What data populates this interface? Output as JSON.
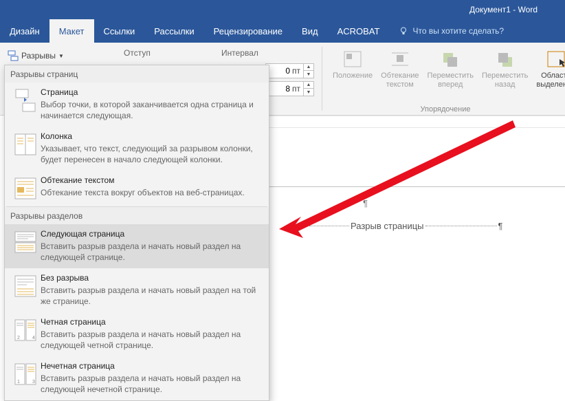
{
  "title": "Документ1 - Word",
  "tabs": [
    "Дизайн",
    "Макет",
    "Ссылки",
    "Рассылки",
    "Рецензирование",
    "Вид",
    "ACROBAT"
  ],
  "active_tab": 1,
  "tell_me": "Что вы хотите сделать?",
  "breaks_button": "Разрывы",
  "indent_label": "Отступ",
  "interval_label": "Интервал",
  "interval_before": "0",
  "interval_after": "8",
  "interval_unit": "пт",
  "arrange": {
    "position": "Положение",
    "wrap": "Обтекание текстом",
    "forward": "Переместить вперед",
    "backward": "Переместить назад",
    "selection": "Область выделения",
    "group_label": "Упорядочение"
  },
  "menu": {
    "sect1": "Разрывы страниц",
    "sect2": "Разрывы разделов",
    "items": [
      {
        "title": "Страница",
        "desc": "Выбор точки, в которой заканчивается одна страница и начинается следующая."
      },
      {
        "title": "Колонка",
        "desc": "Указывает, что текст, следующий за разрывом колонки, будет перенесен в начало следующей колонки."
      },
      {
        "title": "Обтекание текстом",
        "desc": "Обтекание текста вокруг объектов на веб-страницах."
      },
      {
        "title": "Следующая страница",
        "desc": "Вставить разрыв раздела и начать новый раздел на следующей странице."
      },
      {
        "title": "Без разрыва",
        "desc": "Вставить разрыв раздела и начать новый раздел на той же странице."
      },
      {
        "title": "Четная страница",
        "desc": "Вставить разрыв раздела и начать новый раздел на следующей четной странице."
      },
      {
        "title": "Нечетная страница",
        "desc": "Вставить разрыв раздела и начать новый раздел на следующей нечетной странице."
      }
    ]
  },
  "doc": {
    "paragraph_mark": "¶",
    "break_text": "Разрыв страницы"
  }
}
